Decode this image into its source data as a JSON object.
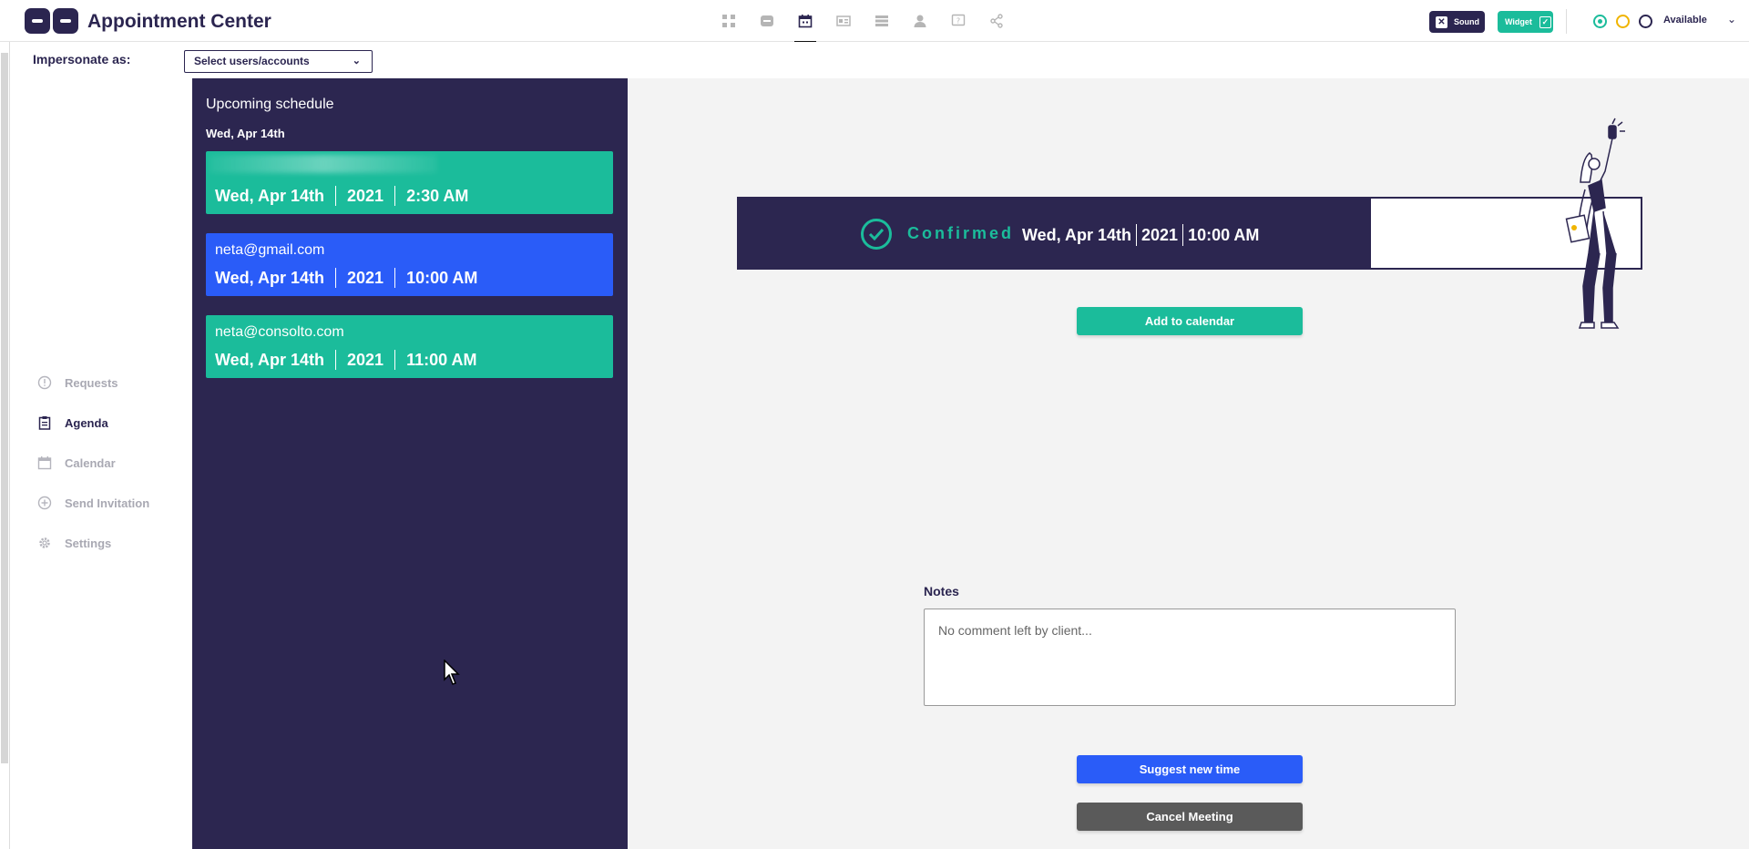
{
  "app": {
    "title": "Appointment Center"
  },
  "nav_icons": [
    "grid-icon",
    "chat-icon",
    "calendar-icon",
    "id-card-icon",
    "list-icon",
    "person-icon",
    "help-icon",
    "share-icon"
  ],
  "toolbar": {
    "sound_label": "Sound",
    "widget_label": "Widget",
    "status_label": "Available"
  },
  "impersonate": {
    "label": "Impersonate as:",
    "select_value": "Select users/accounts"
  },
  "sidebar": {
    "items": [
      {
        "label": "Requests",
        "icon": "alert-circle-icon",
        "active": false
      },
      {
        "label": "Agenda",
        "icon": "clipboard-icon",
        "active": true
      },
      {
        "label": "Calendar",
        "icon": "calendar-icon",
        "active": false
      },
      {
        "label": "Send Invitation",
        "icon": "plus-circle-icon",
        "active": false
      },
      {
        "label": "Settings",
        "icon": "gear-icon",
        "active": false
      }
    ]
  },
  "schedule": {
    "title": "Upcoming schedule",
    "date_heading": "Wed, Apr 14th",
    "appointments": [
      {
        "email": "",
        "date": "Wed, Apr 14th",
        "year": "2021",
        "time": "2:30 AM",
        "color": "#1bbc9b"
      },
      {
        "email": "neta@gmail.com",
        "date": "Wed, Apr 14th",
        "year": "2021",
        "time": "10:00 AM",
        "color": "#2a5cf8"
      },
      {
        "email": "neta@consolto.com",
        "date": "Wed, Apr 14th",
        "year": "2021",
        "time": "11:00 AM",
        "color": "#1bbc9b"
      }
    ]
  },
  "confirmation": {
    "status": "Confirmed",
    "date": "Wed, Apr 14th",
    "year": "2021",
    "time": "10:00 AM"
  },
  "actions": {
    "add_to_calendar": "Add to calendar",
    "suggest_new_time": "Suggest new time",
    "cancel_meeting": "Cancel Meeting"
  },
  "notes": {
    "label": "Notes",
    "placeholder": "No comment left by client..."
  },
  "colors": {
    "brand_dark": "#2c2650",
    "accent_teal": "#1bbc9b",
    "accent_blue": "#2a5cf8",
    "cancel_gray": "#5a5a5a"
  }
}
